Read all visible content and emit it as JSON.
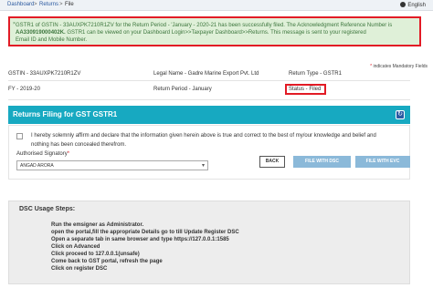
{
  "breadcrumb": {
    "items": [
      "Dashboard",
      "Returns",
      "File"
    ],
    "separator": ">"
  },
  "language": {
    "label": "English"
  },
  "alert": {
    "close_glyph": "×",
    "line1": "GSTR1 of GSTIN - 33AUXPK7210R1ZV for the Return Period - 'January - 2020-21 has been successfully filed. The Acknowledgment Reference Number is",
    "line2_bold": "AA330919000402K.",
    "line2_rest": " GSTR1 can be viewed on your Dashboard Login>>Taxpayer Dashboard>>Returns. This message is sent to your registered",
    "line3": "Email ID and Mobile Number."
  },
  "mandatory_note": {
    "star": "*",
    "text": " indicates Mandatory Fields"
  },
  "return_info": {
    "gstin": "GSTIN - 33AUXPK7210R1ZV",
    "legal_name": "Legal Name - Gadre Marine Export Pvt. Ltd",
    "return_type": "Return Type - GSTR1",
    "fy": "FY - 2019-20",
    "return_period": "Return Period - January",
    "status": "Status - Filed"
  },
  "filing_section": {
    "title": "Returns Filing for GST GSTR1",
    "declaration_line1": "I hereby solemnly affirm and declare that the information given herein above is true and correct to the best of my/our knowledge and belief and",
    "declaration_line2": "nothing has been concealed therefrom.",
    "auth_label": "Authorised Signatory",
    "auth_star": "*",
    "signatory_value": "ANGAD ARORA"
  },
  "buttons": {
    "back": "BACK",
    "file_dsc": "FILE WITH DSC",
    "file_evc": "FILE WITH EVC"
  },
  "dsc_steps": {
    "title": "DSC Usage Steps:",
    "steps": [
      "Run the emsigner as Administrator.",
      "open the portal,fill the appropriate Details go to till Update Register DSC",
      "Open a separate tab in same browser and type https://127.0.0.1:1585",
      "Click on Advanced",
      "Click proceed to 127.0.0.1(unsafe)",
      "Come back to GST portal, refresh the page",
      "Click on register DSC"
    ]
  },
  "colors": {
    "section_header": "#17a9c1",
    "alert_bg": "#dff0d8",
    "highlight_red": "#e21b25",
    "disabled_button": "#8bb9d9"
  }
}
